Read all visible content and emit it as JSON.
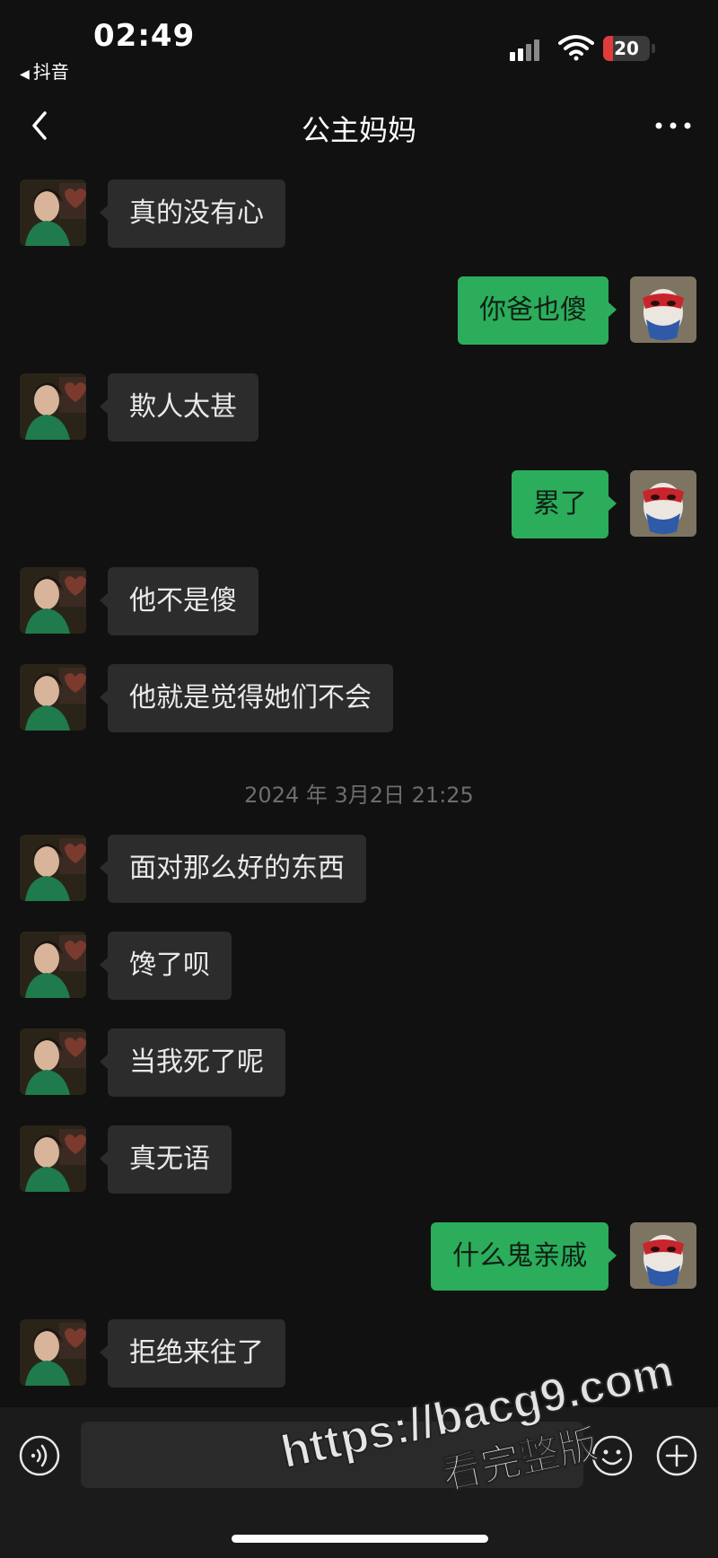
{
  "status_bar": {
    "time": "02:49",
    "back_app": "抖音",
    "battery": "20"
  },
  "header": {
    "title": "公主妈妈",
    "back_icon": "chevron-left-icon",
    "more_icon": "more-dots-icon"
  },
  "messages": [
    {
      "side": "in",
      "text": "真的没有心"
    },
    {
      "side": "out",
      "text": "你爸也傻"
    },
    {
      "side": "in",
      "text": "欺人太甚"
    },
    {
      "side": "out",
      "text": "累了"
    },
    {
      "side": "in",
      "text": "他不是傻"
    },
    {
      "side": "in",
      "text": "他就是觉得她们不会"
    },
    {
      "side": "in",
      "text": "面对那么好的东西"
    },
    {
      "side": "in",
      "text": "馋了呗"
    },
    {
      "side": "in",
      "text": "当我死了呢"
    },
    {
      "side": "in",
      "text": "真无语"
    },
    {
      "side": "out",
      "text": "什么鬼亲戚"
    },
    {
      "side": "in",
      "text": "拒绝来往了"
    }
  ],
  "timestamp": "2024 年 3月2日 21:25",
  "input_bar": {
    "placeholder": "",
    "voice_icon": "voice-icon",
    "emoji_icon": "emoji-icon",
    "plus_icon": "plus-icon"
  },
  "watermark": {
    "url": "https://bacg9.com",
    "text": "看完整版"
  },
  "colors": {
    "background": "#111111",
    "incoming_bubble": "#2c2c2c",
    "outgoing_bubble": "#2bad5c",
    "battery_low": "#e03b3b"
  }
}
